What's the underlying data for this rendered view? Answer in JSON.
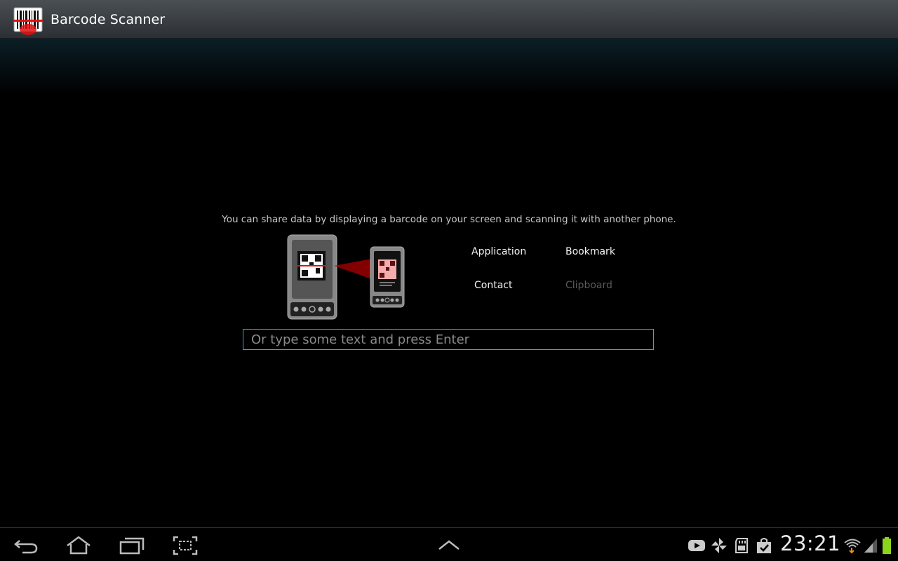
{
  "actionbar": {
    "title": "Barcode Scanner",
    "icon": "barcode-scanner-app-icon"
  },
  "content": {
    "instruction": "You can share data by displaying a barcode on your screen and scanning it with another phone.",
    "share_options": [
      {
        "label": "Application",
        "enabled": true
      },
      {
        "label": "Bookmark",
        "enabled": true
      },
      {
        "label": "Contact",
        "enabled": true
      },
      {
        "label": "Clipboard",
        "enabled": false
      }
    ],
    "text_input": {
      "placeholder": "Or type some text and press Enter",
      "value": ""
    },
    "illustration": "phone-scanning-phone-illustration"
  },
  "system_bar": {
    "nav": [
      "back-icon",
      "home-icon",
      "recent-apps-icon",
      "screenshot-icon",
      "up-arrow-icon"
    ],
    "notifications": [
      "youtube-icon",
      "pinwheel-icon",
      "sd-card-icon",
      "shopping-bag-check-icon"
    ],
    "time": "23:21",
    "status": [
      "wifi-download-icon",
      "signal-icon",
      "battery-icon"
    ]
  },
  "colors": {
    "accent": "#33a8d8",
    "background": "#000000",
    "battery": "#8bd41d",
    "laser": "#e01010"
  }
}
